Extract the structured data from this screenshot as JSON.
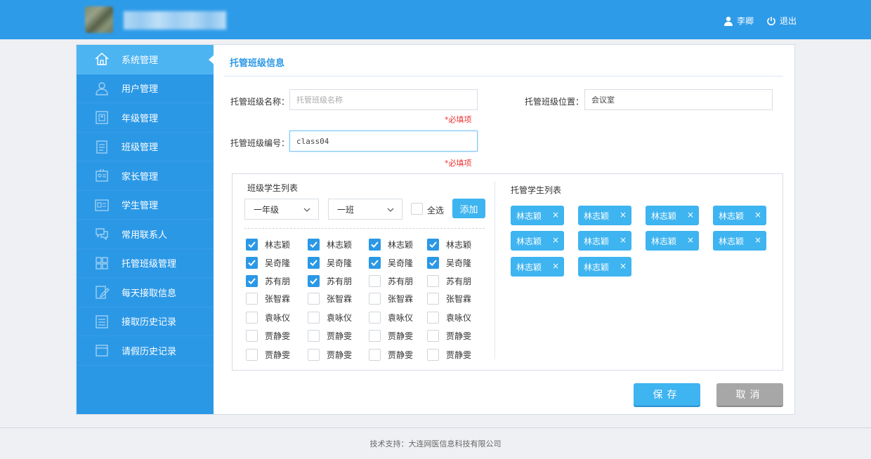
{
  "header": {
    "user_name": "李卿",
    "logout_label": "退出"
  },
  "sidebar": {
    "items": [
      {
        "label": "系统管理",
        "icon": "home-icon",
        "active": true
      },
      {
        "label": "用户管理",
        "icon": "user-icon"
      },
      {
        "label": "年级管理",
        "icon": "grade-icon"
      },
      {
        "label": "班级管理",
        "icon": "class-icon"
      },
      {
        "label": "家长管理",
        "icon": "parent-icon"
      },
      {
        "label": "学生管理",
        "icon": "student-icon"
      },
      {
        "label": "常用联系人",
        "icon": "chat-icon"
      },
      {
        "label": "托管班级管理",
        "icon": "grid-icon"
      },
      {
        "label": "每天接取信息",
        "icon": "edit-icon"
      },
      {
        "label": "接取历史记录",
        "icon": "list-icon"
      },
      {
        "label": "请假历史记录",
        "icon": "window-icon"
      }
    ]
  },
  "page": {
    "title": "托管班级信息",
    "name_label": "托管班级名称：",
    "name_placeholder": "托管班级名称",
    "location_label": "托管班级位置：",
    "location_value": "会议室",
    "code_label": "托管班级编号：",
    "code_value": "class04",
    "required_text": "*必填项"
  },
  "class_students": {
    "title": "班级学生列表",
    "grade_select": "一年级",
    "class_select": "一班",
    "check_all_label": "全选",
    "add_label": "添加",
    "rows": [
      [
        {
          "name": "林志颖",
          "checked": true
        },
        {
          "name": "林志颖",
          "checked": true
        },
        {
          "name": "林志颖",
          "checked": true
        },
        {
          "name": "林志颖",
          "checked": true
        }
      ],
      [
        {
          "name": "吴奇隆",
          "checked": true
        },
        {
          "name": "吴奇隆",
          "checked": true
        },
        {
          "name": "吴奇隆",
          "checked": true
        },
        {
          "name": "吴奇隆",
          "checked": true
        }
      ],
      [
        {
          "name": "苏有朋",
          "checked": true
        },
        {
          "name": "苏有朋",
          "checked": true
        },
        {
          "name": "苏有朋",
          "checked": false
        },
        {
          "name": "苏有朋",
          "checked": false
        }
      ],
      [
        {
          "name": "张智霖",
          "checked": false
        },
        {
          "name": "张智霖",
          "checked": false
        },
        {
          "name": "张智霖",
          "checked": false
        },
        {
          "name": "张智霖",
          "checked": false
        }
      ],
      [
        {
          "name": "袁咏仪",
          "checked": false
        },
        {
          "name": "袁咏仪",
          "checked": false
        },
        {
          "name": "袁咏仪",
          "checked": false
        },
        {
          "name": "袁咏仪",
          "checked": false
        }
      ],
      [
        {
          "name": "贾静雯",
          "checked": false
        },
        {
          "name": "贾静雯",
          "checked": false
        },
        {
          "name": "贾静雯",
          "checked": false
        },
        {
          "name": "贾静雯",
          "checked": false
        }
      ],
      [
        {
          "name": "贾静雯",
          "checked": false
        },
        {
          "name": "贾静雯",
          "checked": false
        },
        {
          "name": "贾静雯",
          "checked": false
        },
        {
          "name": "贾静雯",
          "checked": false
        }
      ]
    ]
  },
  "care_students": {
    "title": "托管学生列表",
    "remove_symbol": "×",
    "tags": [
      "林志颖",
      "林志颖",
      "林志颖",
      "林志颖",
      "林志颖",
      "林志颖",
      "林志颖",
      "林志颖",
      "林志颖",
      "林志颖"
    ]
  },
  "actions": {
    "save_label": "保存",
    "cancel_label": "取消"
  },
  "footer": {
    "text": "技术支持：大连网医信息科技有限公司"
  },
  "colors": {
    "primary": "#2b98e6",
    "accent": "#3eb4f0",
    "required": "#ee3333"
  }
}
